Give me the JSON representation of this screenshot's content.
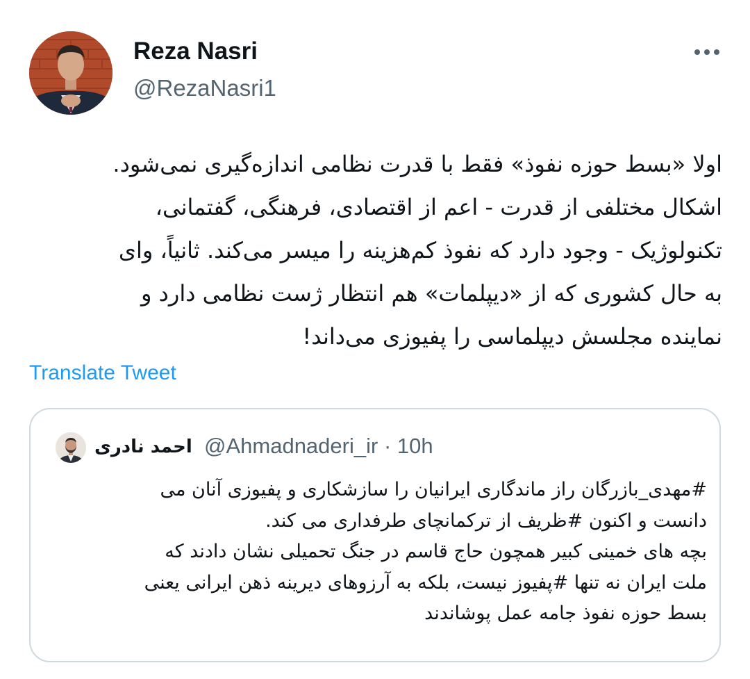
{
  "author": {
    "display_name": "Reza Nasri",
    "handle": "@RezaNasri1"
  },
  "header": {
    "more_icon": "more-horizontal-icon"
  },
  "tweet": {
    "lines": [
      "اولا «بسط حوزه نفوذ» فقط با قدرت نظامی اندازه‌گیری نمی‌شود.",
      "اشکال مختلفی از قدرت - اعم از اقتصادی، فرهنگی، گفتمانی،",
      "تکنولوژیک - وجود دارد که نفوذ کم‌هزینه را میسر می‌کند. ثانیاً، وای",
      "به حال کشوری که از «دیپلمات» هم انتظار ژست نظامی دارد و",
      "نماینده مجلسش دیپلماسی را پفیوزی می‌داند!"
    ],
    "translate_label": "Translate Tweet"
  },
  "quoted_tweet": {
    "display_name": "احمد نادری",
    "handle": "@Ahmadnaderi_ir",
    "separator": "·",
    "time": "10h",
    "lines": [
      "#مهدی_بازرگان راز ماندگاری ایرانیان را سازشکاری و پفیوزی آنان می",
      "دانست و اکنون #ظریف از ترکمانچای طرفداری می کند.",
      "بچه های خمینی کبیر همچون حاج قاسم در جنگ تحمیلی نشان دادند که",
      "ملت ایران نه تنها #پفیوز نیست، بلکه به آرزوهای دیرینه ذهن ایرانی یعنی",
      "بسط حوزه نفوذ جامه عمل پوشاندند"
    ]
  },
  "colors": {
    "text": "#0f1419",
    "secondary": "#536471",
    "link": "#1d9bf0",
    "border": "#cfd9de"
  }
}
